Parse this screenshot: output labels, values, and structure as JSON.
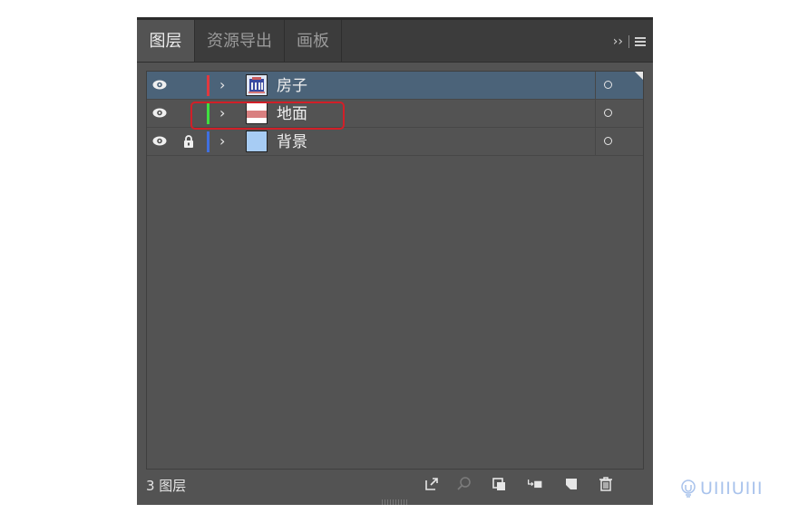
{
  "tabs": [
    {
      "label": "图层",
      "active": true
    },
    {
      "label": "资源导出",
      "active": false
    },
    {
      "label": "画板",
      "active": false
    }
  ],
  "tabbar": {
    "expand_label": "››",
    "menu_icon": "hamburger-menu-icon"
  },
  "layers": [
    {
      "name": "房子",
      "color": "#e0393f",
      "visible": true,
      "locked": false,
      "selected": true,
      "thumb": "house-thumbnail"
    },
    {
      "name": "地面",
      "color": "#3fe03f",
      "visible": true,
      "locked": false,
      "selected": false,
      "thumb": "ground-thumbnail"
    },
    {
      "name": "背景",
      "color": "#3f6fe0",
      "visible": true,
      "locked": true,
      "selected": false,
      "thumb": "background-thumbnail"
    }
  ],
  "footer": {
    "layer_count": "3 图层",
    "icons": [
      "export-icon",
      "search-icon",
      "make-clipping-mask-icon",
      "new-sublayer-icon",
      "new-layer-icon",
      "delete-icon"
    ]
  },
  "watermark": {
    "text": "UIIIUIII"
  },
  "annotation": {
    "color": "#d21f28"
  }
}
